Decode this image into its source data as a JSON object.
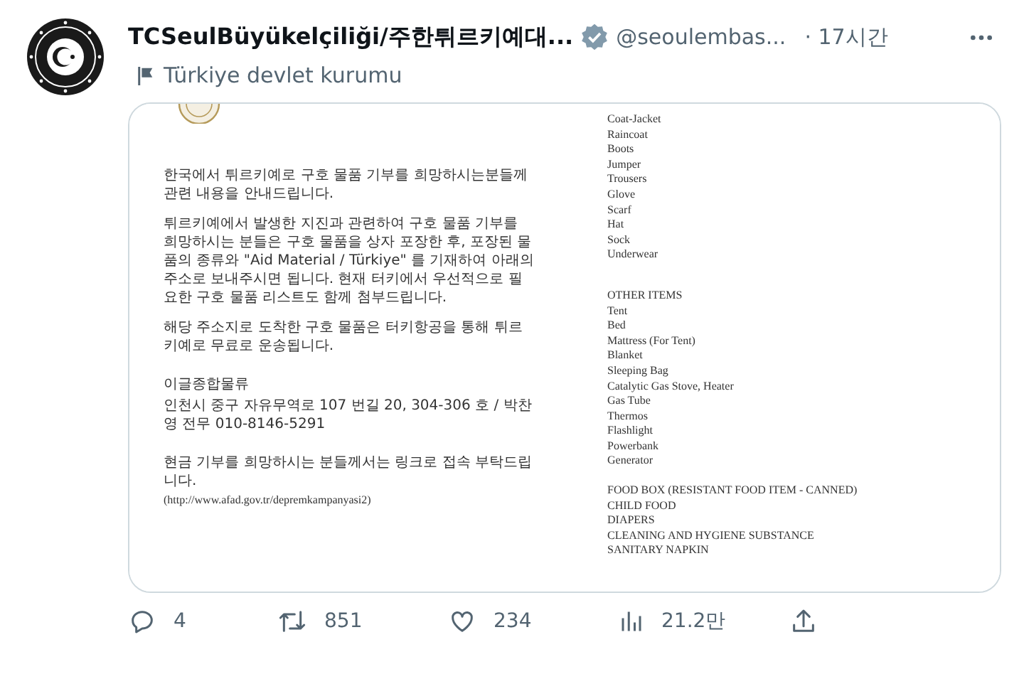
{
  "post": {
    "author": {
      "name": "TCSeulBüyükelçiliği/주한튀르키예대...",
      "verified": true,
      "handle": "@seoulembas...",
      "time": "· 17시간"
    },
    "label": "Türkiye devlet kurumu",
    "media": [
      {
        "kind": "letter",
        "paragraphs": [
          "한국에서 튀르키예로 구호 물품 기부를 희망하시는분들께 관련 내용을 안내드립니다.",
          "튀르키예에서 발생한 지진과 관련하여 구호 물품 기부를 희망하시는 분들은 구호 물품을 상자 포장한 후, 포장된 물품의 종류와 \"Aid Material / Türkiye\" 를 기재하여 아래의 주소로 보내주시면 됩니다. 현재 터키에서 우선적으로 필요한 구호 물품 리스트도 함께 첨부드립니다.",
          "해당 주소지로 도착한 구호 물품은 터키항공을 통해 튀르키예로 무료로 운송됩니다."
        ],
        "sender": "이글종합물류",
        "address": "인천시 중구 자유무역로 107 번길 20, 304-306 호 / 박찬영 전무 010-8146-5291",
        "cash_note": "현금 기부를 희망하시는 분들께서는 링크로 접속 부탁드립니다.",
        "link": "(http://www.afad.gov.tr/depremkampanyasi2)"
      },
      {
        "kind": "list",
        "groups": [
          {
            "items": [
              "Coat-Jacket",
              "Raincoat",
              "Boots",
              "Jumper",
              "Trousers",
              "Glove",
              "Scarf",
              "Hat",
              "Sock",
              "Underwear"
            ]
          },
          {
            "heading": "OTHER ITEMS",
            "items": [
              "Tent",
              "Bed",
              "Mattress (For Tent)",
              "Blanket",
              "Sleeping Bag",
              "Catalytic Gas Stove, Heater",
              "Gas Tube",
              "Thermos",
              "Flashlight",
              "Powerbank",
              "Generator"
            ]
          },
          {
            "items": [
              "FOOD BOX (RESISTANT FOOD ITEM - CANNED)",
              "CHILD FOOD",
              "DIAPERS",
              "CLEANING AND HYGIENE SUBSTANCE",
              "SANITARY NAPKIN"
            ]
          }
        ]
      }
    ],
    "actions": [
      {
        "kind": "reply",
        "count": "4"
      },
      {
        "kind": "repost",
        "count": "851"
      },
      {
        "kind": "like",
        "count": "234"
      },
      {
        "kind": "views",
        "count": "21.2만"
      },
      {
        "kind": "share"
      }
    ]
  }
}
